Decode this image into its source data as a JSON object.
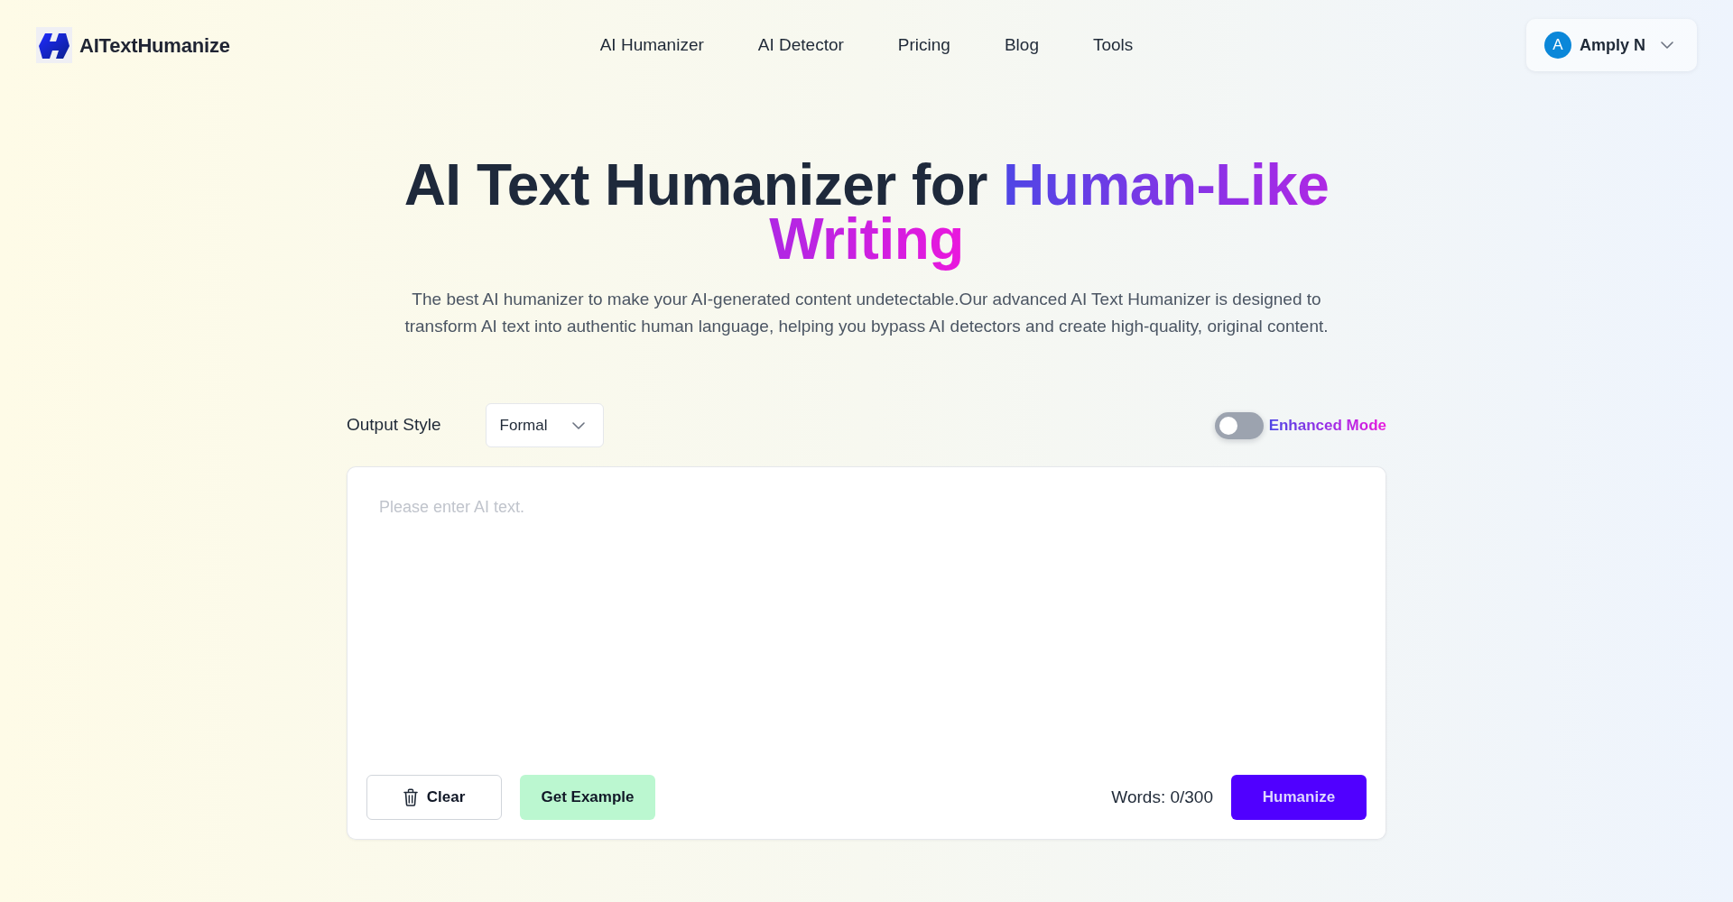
{
  "header": {
    "brand": "AITextHumanize",
    "nav": [
      "AI Humanizer",
      "AI Detector",
      "Pricing",
      "Blog",
      "Tools"
    ],
    "account": {
      "initial": "A",
      "name": "Amply N"
    }
  },
  "hero": {
    "title": "AI Text Humanizer for",
    "title_highlight": "Human-Like Writing",
    "subtitle": "The best AI humanizer to make your AI-generated content undetectable.Our advanced AI Text Humanizer is designed to transform AI text into authentic human language, helping you bypass AI detectors and create high-quality, original content."
  },
  "options": {
    "output_style": {
      "label": "Output Style",
      "value": "Formal"
    },
    "enhanced_mode": {
      "label": "Enhanced Mode",
      "on": false
    }
  },
  "editor": {
    "placeholder": "Please enter AI text.",
    "buttons": [
      {
        "kind": "clear",
        "label": "Clear"
      },
      {
        "kind": "example",
        "label": "Get Example"
      }
    ],
    "word_count": "Words: 0/300",
    "submit": "Humanize"
  }
}
